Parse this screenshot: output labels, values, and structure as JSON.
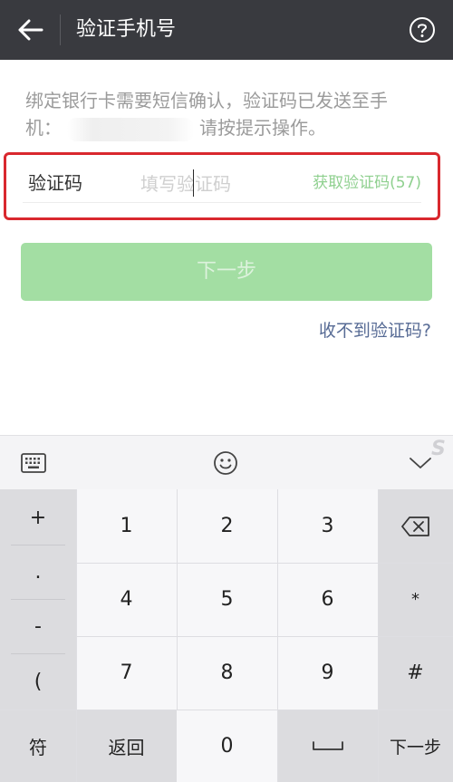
{
  "header": {
    "back_icon": "arrow-left-icon",
    "title": "验证手机号",
    "help_icon": "question-circle-icon"
  },
  "hint": {
    "line1": "绑定银行卡需要短信确认，验证码已发送至手",
    "line2_prefix": "机：",
    "line2_suffix": "请按提示操作。"
  },
  "code_field": {
    "label": "验证码",
    "placeholder": "填写验证码",
    "value": "",
    "get_code_label": "获取验证码(57)"
  },
  "next_button": {
    "label": "下一步"
  },
  "no_code_link": "收不到验证码?",
  "keyboard": {
    "toolbar": {
      "keyboard_icon": "keyboard-icon",
      "emoji_icon": "smiley-icon",
      "collapse_icon": "chevron-down-icon",
      "watermark": "S"
    },
    "symbols": [
      "+",
      ".",
      "-",
      "("
    ],
    "digits": [
      [
        "1",
        "2",
        "3"
      ],
      [
        "4",
        "5",
        "6"
      ],
      [
        "7",
        "8",
        "9"
      ]
    ],
    "right_keys": [
      "⌫",
      "*",
      "#"
    ],
    "bottom": {
      "symbols_key": "符",
      "back_key": "返回",
      "zero": "0",
      "space": "␣",
      "next": "下一步"
    }
  },
  "colors": {
    "header_bg": "#393a3f",
    "highlight_border": "#d9282e",
    "button_green": "#a3dea3",
    "get_code_green": "#8fd08f",
    "link_blue": "#576b95"
  }
}
